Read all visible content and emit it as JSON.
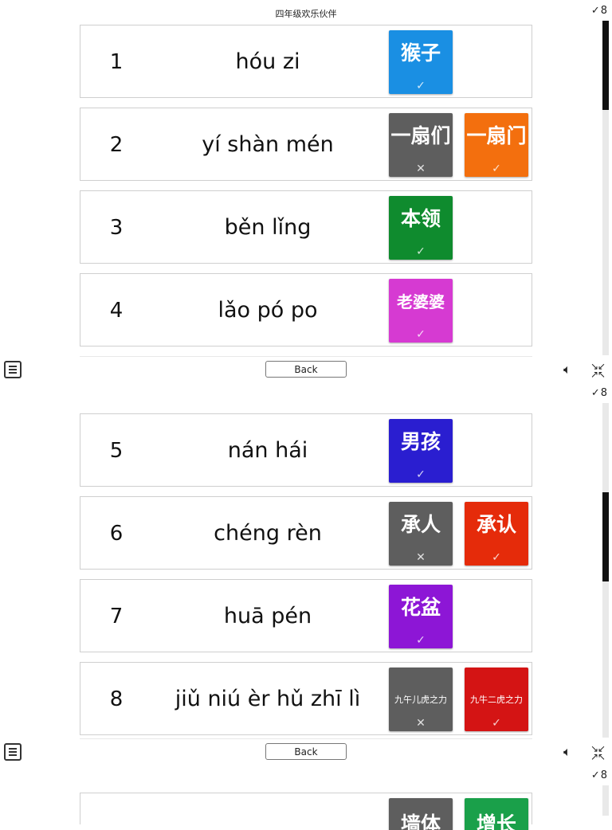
{
  "title": "四年级欢乐伙伴",
  "score": "8",
  "back_label": "Back",
  "rows": [
    {
      "num": "1",
      "pinyin": "hóu zi",
      "choices": [
        {
          "text": "猴子",
          "mark": "✓",
          "color": "#1a8fe3"
        }
      ]
    },
    {
      "num": "2",
      "pinyin": "yí shàn mén",
      "choices": [
        {
          "text": "一扇们",
          "mark": "✕",
          "color": "#5e5e5e"
        },
        {
          "text": "一扇门",
          "mark": "✓",
          "color": "#f36f0e"
        }
      ]
    },
    {
      "num": "3",
      "pinyin": "běn lǐng",
      "choices": [
        {
          "text": "本领",
          "mark": "✓",
          "color": "#0f8b2e"
        }
      ]
    },
    {
      "num": "4",
      "pinyin": "lǎo pó po",
      "choices": [
        {
          "text": "老婆婆",
          "mark": "✓",
          "color": "#d63ad2"
        }
      ]
    },
    {
      "num": "5",
      "pinyin": "nán hái",
      "choices": [
        {
          "text": "男孩",
          "mark": "✓",
          "color": "#2a1ed0"
        }
      ]
    },
    {
      "num": "6",
      "pinyin": "chéng rèn",
      "choices": [
        {
          "text": "承人",
          "mark": "✕",
          "color": "#5e5e5e"
        },
        {
          "text": "承认",
          "mark": "✓",
          "color": "#e52b0a"
        }
      ]
    },
    {
      "num": "7",
      "pinyin": "huā pén",
      "choices": [
        {
          "text": "花盆",
          "mark": "✓",
          "color": "#8d16d6"
        }
      ]
    },
    {
      "num": "8",
      "pinyin": "jiǔ niú èr hǔ zhī lì",
      "choices": [
        {
          "text": "九午儿虎之力",
          "mark": "✕",
          "color": "#5e5e5e"
        },
        {
          "text": "九牛二虎之力",
          "mark": "✓",
          "color": "#d41414"
        }
      ]
    }
  ],
  "partial_row": {
    "choices": [
      {
        "text": "墙体",
        "color": "#5e5e5e"
      },
      {
        "text": "增长",
        "color": "#1aa04a"
      }
    ]
  },
  "icons": {
    "menu": "menu-icon",
    "sound": "speaker-icon",
    "shrink": "shrink-icon",
    "check": "check-icon"
  }
}
